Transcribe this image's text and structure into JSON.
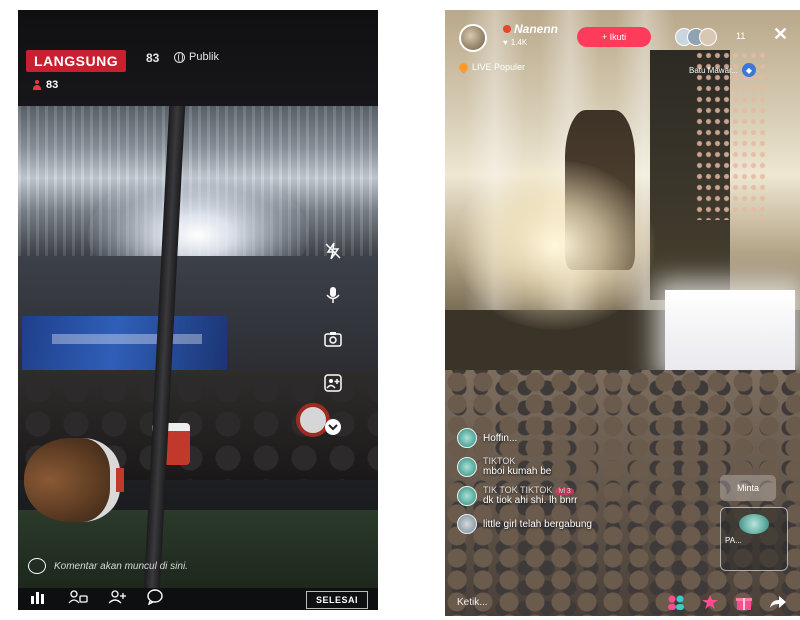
{
  "left_stream": {
    "live_badge": "LANGSUNG",
    "viewer_count_top": "83",
    "visibility": "Publik",
    "viewers_label": "83",
    "comment_placeholder": "Komentar akan muncul di sini.",
    "end_button": "SELESAI",
    "side_tools": [
      "flash-off-icon",
      "microphone-icon",
      "flip-camera-icon",
      "add-guest-icon",
      "more-chevron-icon"
    ],
    "bottom_icons": [
      "stats-icon",
      "invite-icon",
      "add-person-icon",
      "comment-icon"
    ],
    "colors": {
      "live_badge": "#c8202e"
    }
  },
  "right_stream": {
    "host_name": "Nanenn",
    "host_likes": "1.4K",
    "follow_button": "+ Ikuti",
    "viewer_count": "11",
    "popular_label": "LIVE Populer",
    "gift_label": "Batu Mawar...",
    "comments": [
      {
        "user": "",
        "text": "Hoffin..."
      },
      {
        "user": "TIKTOK",
        "text": "mboi kumah be"
      },
      {
        "user": "TIK TOK TIKTOK",
        "level": "lvl 3",
        "text": "dk tiok ahi shi. lh bnrr"
      },
      {
        "user": "",
        "text": "little girl telah bergabung"
      }
    ],
    "request_button": "Minta",
    "guest_card_label": "PA...",
    "type_placeholder": "Ketik...",
    "colors": {
      "follow": "#ff3b5c"
    }
  }
}
